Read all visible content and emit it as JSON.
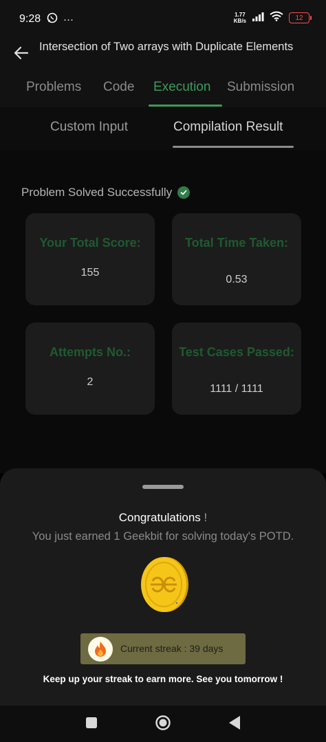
{
  "status_bar": {
    "time": "9:28",
    "more": "···",
    "net_speed_value": "1.77",
    "net_speed_unit": "KB/s",
    "battery": "12"
  },
  "header": {
    "title": "Intersection of Two arrays with Duplicate Elements"
  },
  "tabs": [
    {
      "label": "Problems",
      "active": false
    },
    {
      "label": "Code",
      "active": false
    },
    {
      "label": "Execution",
      "active": true
    },
    {
      "label": "Submission",
      "active": false
    }
  ],
  "subtabs": [
    {
      "label": "Custom Input",
      "active": false
    },
    {
      "label": "Compilation Result",
      "active": true
    }
  ],
  "result": {
    "status": "Problem Solved Successfully",
    "cards": [
      {
        "label": "Your Total Score:",
        "value": "155"
      },
      {
        "label": "Total Time Taken:",
        "value": "0.53"
      },
      {
        "label": "Attempts No.:",
        "value": "2"
      },
      {
        "label": "Test Cases Passed:",
        "value": "1111 / 1111"
      }
    ]
  },
  "sheet": {
    "congrats": "Congratulations",
    "congrats_bang": "!",
    "earned": "You just earned 1 Geekbit for solving today's POTD.",
    "streak": "Current streak : 39 days",
    "keep_up": "Keep up your streak to earn more. See you tomorrow !"
  },
  "colors": {
    "accent": "#3d9a5c",
    "card_label": "#1f5a30",
    "streak_bg": "#6e6a41",
    "coin": "#f5c518"
  },
  "icons": [
    "back-arrow-icon",
    "whatsapp-icon",
    "signal-icon",
    "wifi-icon",
    "battery-icon",
    "check-circle-icon",
    "coin-icon",
    "flame-icon",
    "recents-icon",
    "home-icon",
    "back-nav-icon"
  ]
}
